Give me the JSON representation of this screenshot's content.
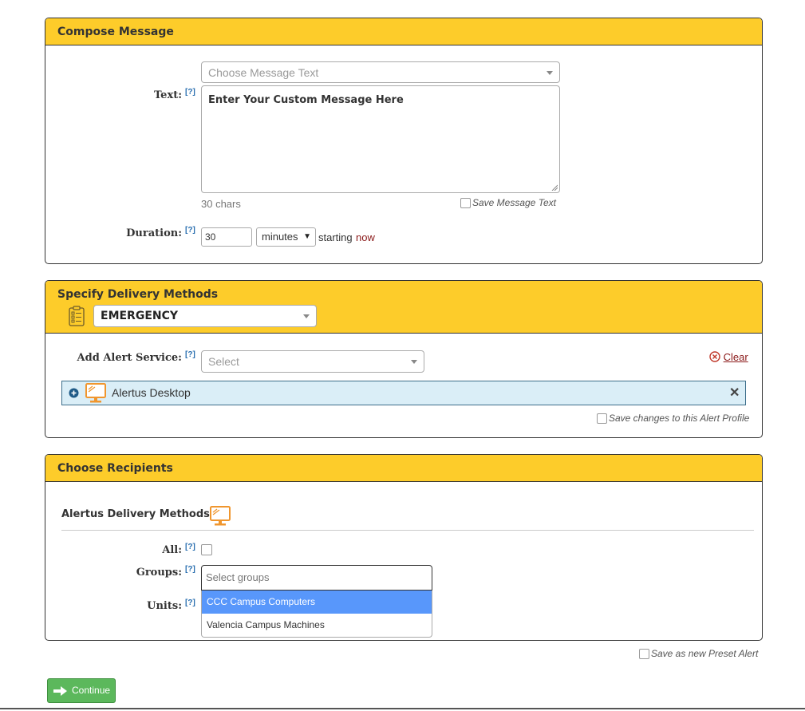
{
  "compose": {
    "title": "Compose Message",
    "text_label": "Text:",
    "help": "[?]",
    "message_text_placeholder": "Choose Message Text",
    "message_body": "Enter Your Custom Message Here",
    "char_count": "30 chars",
    "save_message_text": "Save Message Text",
    "duration_label": "Duration:",
    "duration_value": "30",
    "duration_unit": "minutes",
    "starting_label": "starting",
    "starting_value": "now"
  },
  "delivery": {
    "title": "Specify Delivery Methods",
    "profile": "EMERGENCY",
    "add_service_label": "Add Alert Service:",
    "service_placeholder": "Select",
    "clear_label": "Clear",
    "service_name": "Alertus Desktop",
    "save_changes_label": "Save changes to this Alert Profile"
  },
  "recipients": {
    "title": "Choose Recipients",
    "methods_label": "Alertus Delivery Methods:",
    "all_label": "All:",
    "groups_label": "Groups:",
    "groups_placeholder": "Select groups",
    "units_label": "Units:",
    "options": [
      "CCC Campus Computers",
      "Valencia Campus Machines"
    ]
  },
  "footer": {
    "save_preset_label": "Save as new Preset Alert",
    "continue_label": "Continue"
  },
  "colors": {
    "header_yellow": "#fdcc2a",
    "service_row_bg": "#daeef7",
    "option_highlight": "#5897fb",
    "continue_green": "#5cb85c",
    "monitor_orange": "#f0962e"
  }
}
